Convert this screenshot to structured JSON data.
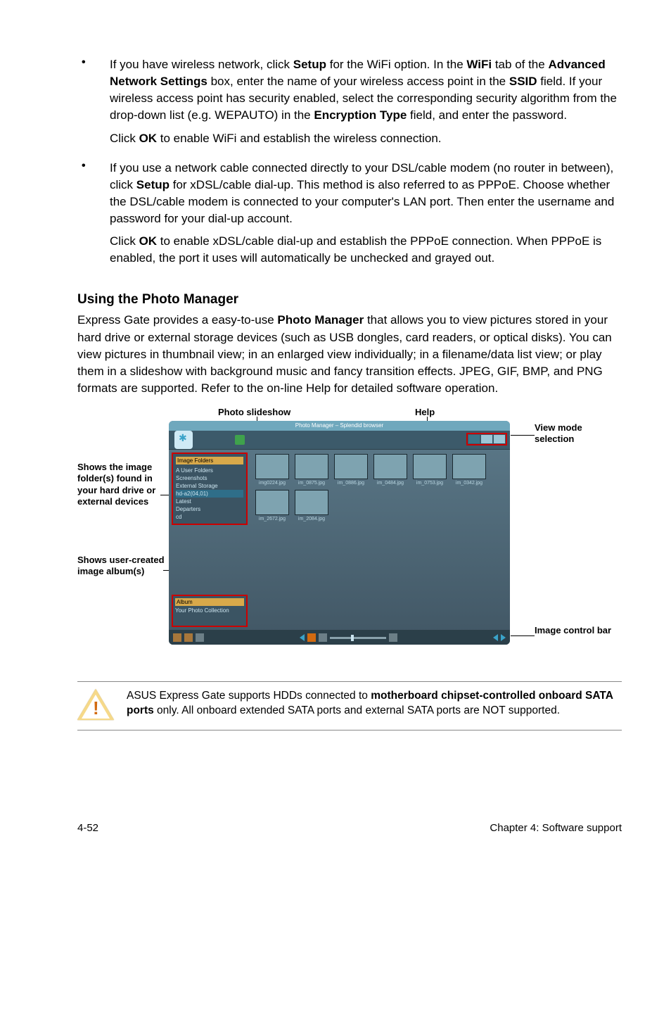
{
  "bullets": [
    {
      "para1_a": "If you have wireless network, click ",
      "para1_b": " for the WiFi option. In the ",
      "para1_c": " tab of the ",
      "para1_d": " box, enter the name of your wireless access point in the ",
      "para1_e": " field. If your wireless access point has security enabled, select the corresponding security algorithm from the drop-down list (e.g. WEPAUTO) in the ",
      "para1_f": " field, and enter the password.",
      "setup": "Setup",
      "wifi": "WiFi",
      "advnet": "Advanced Network Settings",
      "ssid": "SSID",
      "enctype": "Encryption Type",
      "para2_a": "Click ",
      "ok": "OK",
      "para2_b": " to enable WiFi and establish the wireless connection."
    },
    {
      "para1_a": "If you use a network cable connected directly to your DSL/cable modem (no router in between), click ",
      "setup": "Setup",
      "para1_b": " for xDSL/cable dial-up. This method is also referred to as PPPoE. Choose whether the DSL/cable modem is connected to your computer's LAN port. Then enter the username and password for your dial-up account.",
      "para2_a": "Click ",
      "ok": "OK",
      "para2_b": " to enable xDSL/cable dial-up and establish the PPPoE connection. When PPPoE is enabled, the port it uses will automatically be unchecked and grayed out."
    }
  ],
  "heading": "Using the Photo Manager",
  "intro_a": "Express Gate  provides a easy-to-use ",
  "intro_bold": "Photo Manager",
  "intro_b": " that allows you to view pictures stored in your hard drive or external storage devices (such as USB dongles, card readers, or optical disks). You can view pictures in thumbnail view; in an enlarged view individually; in a filename/data list view; or play them in a slideshow with background music and fancy transition effects. JPEG, GIF, BMP, and PNG formats are supported. Refer to the on-line Help for detailed software operation.",
  "callouts": {
    "photo_slideshow": "Photo slideshow",
    "help": "Help",
    "view_mode": "View mode selection",
    "folders": "Shows the image folder(s) found in your hard drive or external devices",
    "albums": "Shows user-created image album(s)",
    "image_bar": "Image control bar"
  },
  "screenshot": {
    "titlebar": "Photo Manager – Splendid browser",
    "folders_header": "Image Folders",
    "folder_items": [
      "A User Folders",
      "Screenshots",
      "External Storage",
      "hd-a2(04,01)",
      "Latest",
      "Departers",
      "cd"
    ],
    "album_header": "Album",
    "album_sub": "Your Photo Collection",
    "thumbs": [
      "img0224.jpg",
      "im_0875.jpg",
      "im_0886.jpg",
      "im_0484.jpg",
      "im_0753.jpg",
      "im_0342.jpg",
      "im_2672.jpg",
      "im_2084.jpg"
    ]
  },
  "note_a": "ASUS Express Gate supports HDDs connected to ",
  "note_bold": "motherboard chipset-controlled onboard SATA ports",
  "note_b": " only. All onboard extended SATA ports and external SATA ports are NOT supported.",
  "footer_left": "4-52",
  "footer_right": "Chapter 4: Software support"
}
